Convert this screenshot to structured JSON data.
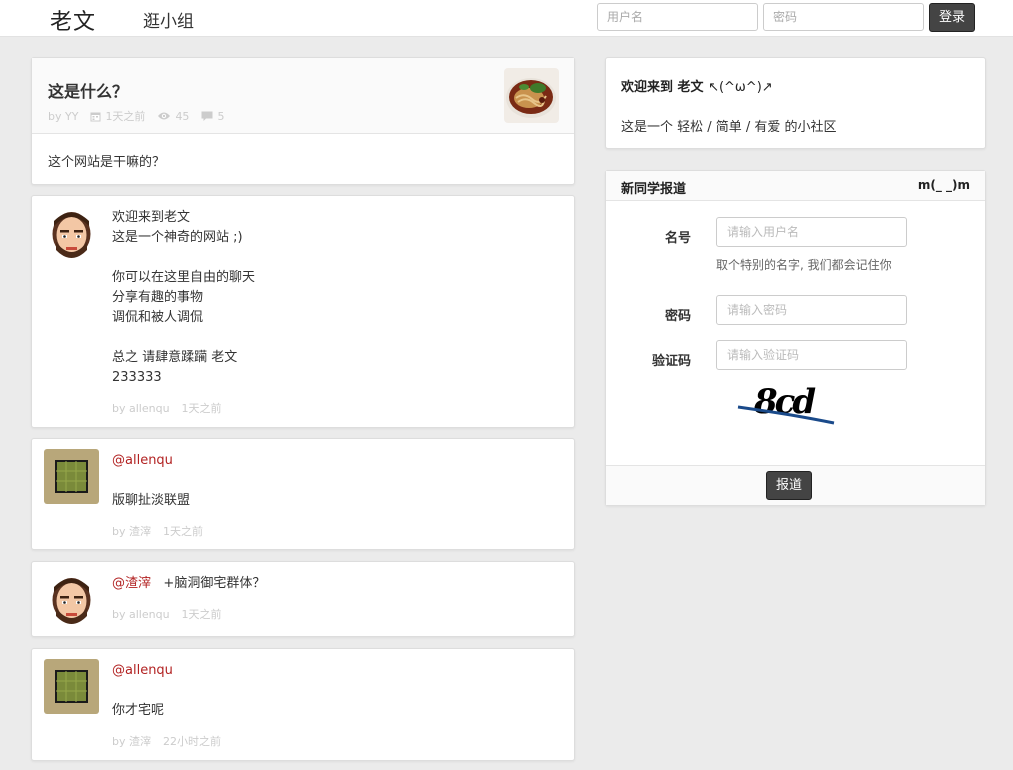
{
  "header": {
    "logo": "老文",
    "nav_groups": "逛小组",
    "username_placeholder": "用户名",
    "password_placeholder": "密码",
    "login_label": "登录"
  },
  "post": {
    "title": "这是什么？",
    "author": "by YY",
    "time": "1天之前",
    "views": "45",
    "comments": "5",
    "body": "这个网站是干嘛的？"
  },
  "replies": [
    {
      "lines": [
        "欢迎来到老文",
        "这是一个神奇的网站 ;)",
        "",
        "你可以在这里自由的聊天",
        "分享有趣的事物",
        "调侃和被人调侃",
        "",
        "总之 请肆意蹂躏 老文",
        "233333"
      ],
      "author": "by allenqu",
      "time": "1天之前",
      "avatar": "face-avatar"
    },
    {
      "mention": "@allenqu",
      "lines": [
        "版聊扯淡联盟"
      ],
      "author": "by 渣滓",
      "time": "1天之前",
      "avatar": "square-avatar"
    },
    {
      "mention": "@渣滓",
      "inline_text": "+脑洞御宅群体？",
      "author": "by allenqu",
      "time": "1天之前",
      "avatar": "face-avatar"
    },
    {
      "mention": "@allenqu",
      "lines": [
        "你才宅呢"
      ],
      "author": "by 渣滓",
      "time": "22小时之前",
      "avatar": "square-avatar"
    }
  ],
  "sidebar": {
    "welcome_title": "欢迎来到 老文",
    "welcome_kaomoji": "↖(^ω^)↗",
    "welcome_text": "这是一个 轻松 / 简单 / 有爱 的小社区",
    "register": {
      "title": "新同学报道",
      "kaomoji": "m(_ _)m",
      "name_label": "名号",
      "name_placeholder": "请输入用户名",
      "name_hint": "取个特别的名字, 我们都会记住你",
      "password_label": "密码",
      "password_placeholder": "请输入密码",
      "captcha_label": "验证码",
      "captcha_placeholder": "请输入验证码",
      "captcha_text": "8cd",
      "submit_label": "报道"
    }
  },
  "colors": {
    "mention": "#b22222",
    "button_bg": "#444444",
    "page_bg": "#ebebeb"
  }
}
